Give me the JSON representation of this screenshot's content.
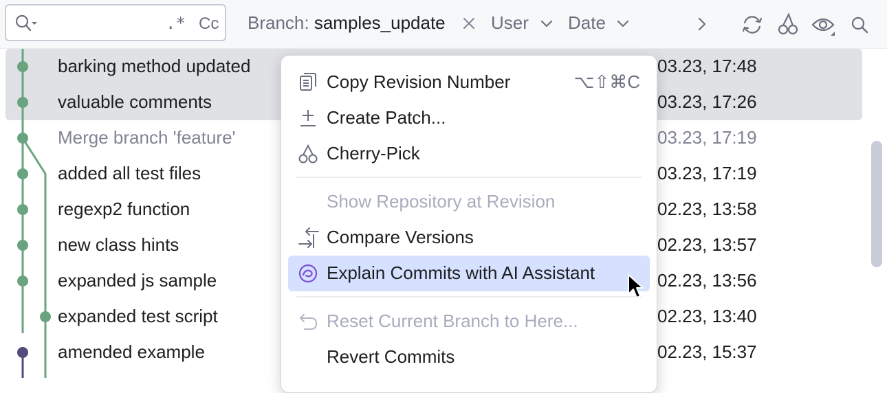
{
  "toolbar": {
    "search_value": "",
    "regex_label": ".*",
    "case_label": "Cc",
    "branch_filter_label": "Branch:",
    "branch_filter_value": "samples_update",
    "user_filter_label": "User",
    "date_filter_label": "Date",
    "icons": [
      "search-icon",
      "clear-filter-icon",
      "chevron-down-icon",
      "chevron-right-icon",
      "refresh-icon",
      "cherry-pick-icon",
      "eye-icon",
      "search-icon"
    ]
  },
  "commits": [
    {
      "message": "barking method updated",
      "date": "03.23, 17:48",
      "selected": true
    },
    {
      "message": "valuable comments",
      "date": "03.23, 17:26",
      "selected": true
    },
    {
      "message": "Merge branch 'feature'",
      "date": "03.23, 17:19",
      "merge": true
    },
    {
      "message": "added all test files",
      "date": "03.23, 17:19"
    },
    {
      "message": "regexp2 function",
      "date": "02.23, 13:58"
    },
    {
      "message": "new class hints",
      "date": "02.23, 13:57"
    },
    {
      "message": "expanded js sample",
      "date": "02.23, 13:56"
    },
    {
      "message": "expanded test script",
      "date": "02.23, 13:40"
    },
    {
      "message": "amended example",
      "date": "02.23, 15:37"
    }
  ],
  "context_menu": {
    "items": [
      {
        "label": "Copy Revision Number",
        "shortcut": "⌥⇧⌘C",
        "icon": "copy-icon"
      },
      {
        "label": "Create Patch...",
        "icon": "patch-icon"
      },
      {
        "label": "Cherry-Pick",
        "icon": "cherry-pick-icon"
      },
      {
        "label": "Show Repository at Revision",
        "disabled": true
      },
      {
        "label": "Compare Versions",
        "icon": "compare-icon"
      },
      {
        "label": "Explain Commits with AI Assistant",
        "icon": "ai-assistant-icon",
        "highlighted": true
      },
      {
        "label": "Reset Current Branch to Here...",
        "icon": "reset-icon",
        "disabled": true
      },
      {
        "label": "Revert Commits"
      }
    ]
  },
  "colors": {
    "graph_main": "#6aa37f",
    "graph_purple": "#544a7d",
    "selection": "#dfe1e5",
    "menu_highlight": "#d5e1ff",
    "ai_icon": "#7b4cd9"
  }
}
